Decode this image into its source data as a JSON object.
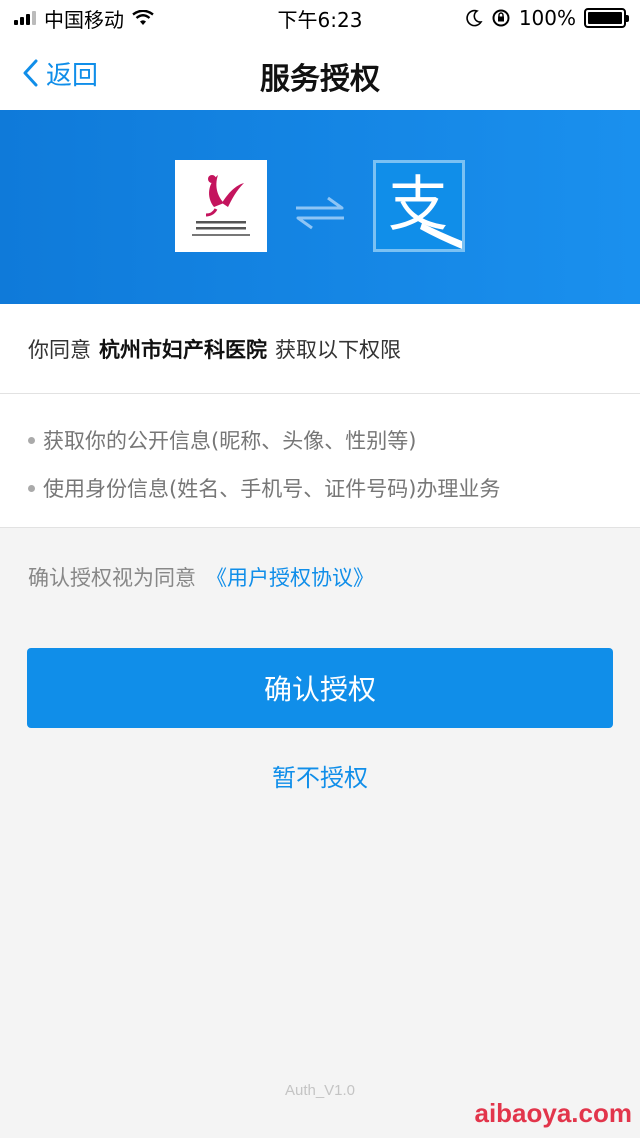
{
  "status_bar": {
    "carrier": "中国移动",
    "time": "下午6:23",
    "battery": "100%",
    "battery_level": 1.0,
    "signal_bars": 3,
    "icons": [
      "signal-icon",
      "wifi-icon",
      "moon-icon",
      "rotation-lock-icon",
      "battery-icon"
    ]
  },
  "nav": {
    "back_label": "返回",
    "title": "服务授权"
  },
  "banner": {
    "bg_color": "#1283e3",
    "icons": [
      "hospital-logo",
      "swap-arrows-icon",
      "alipay-logo"
    ],
    "alipay_glyph": "支"
  },
  "consent": {
    "prefix": "你同意",
    "org_name": "杭州市妇产科医院",
    "suffix": "获取以下权限"
  },
  "permissions": [
    "获取你的公开信息(昵称、头像、性别等)",
    "使用身份信息(姓名、手机号、证件号码)办理业务"
  ],
  "agreement": {
    "text": "确认授权视为同意",
    "link": "《用户授权协议》"
  },
  "buttons": {
    "confirm": "确认授权",
    "decline": "暂不授权"
  },
  "version": "Auth_V1.0",
  "watermark": "aibaoya.com",
  "colors": {
    "accent": "#108ee9",
    "background": "#f4f4f4"
  }
}
